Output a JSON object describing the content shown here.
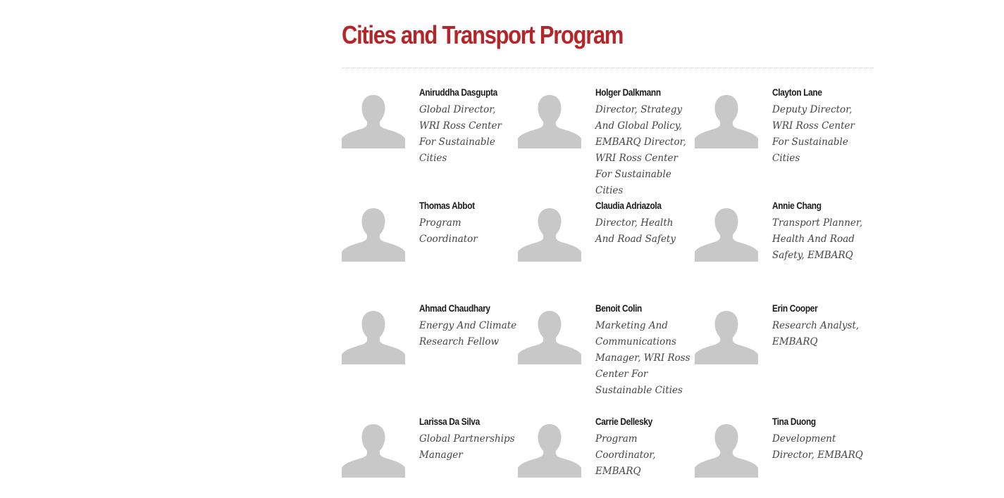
{
  "section": {
    "title": "Cities and Transport Program"
  },
  "avatar_icon": "person-silhouette-placeholder",
  "colors": {
    "title": "#b5262a",
    "avatar": "#c8c8c8",
    "name": "#1a1a1a",
    "role": "#444444"
  },
  "people": [
    {
      "name": "Aniruddha Dasgupta",
      "role": "Global Director, WRI Ross Center For Sustainable Cities"
    },
    {
      "name": "Holger Dalkmann",
      "role": "Director, Strategy And Global Policy, EMBARQ Director, WRI Ross Center For Sustainable Cities"
    },
    {
      "name": "Clayton Lane",
      "role": "Deputy Director, WRI Ross Center For Sustainable Cities"
    },
    {
      "name": "Thomas Abbot",
      "role": "Program Coordinator"
    },
    {
      "name": "Claudia Adriazola",
      "role": "Director, Health And Road Safety"
    },
    {
      "name": "Annie Chang",
      "role": "Transport Planner, Health And Road Safety, EMBARQ"
    },
    {
      "name": "Ahmad Chaudhary",
      "role": "Energy And Climate Research Fellow"
    },
    {
      "name": "Benoit Colin",
      "role": "Marketing And Communications Manager, WRI Ross Center For Sustainable Cities"
    },
    {
      "name": "Erin Cooper",
      "role": "Research Analyst, EMBARQ"
    },
    {
      "name": "Larissa Da Silva",
      "role": "Global Partnerships Manager"
    },
    {
      "name": "Carrie Dellesky",
      "role": "Program Coordinator, EMBARQ"
    },
    {
      "name": "Tina Duong",
      "role": "Development Director, EMBARQ"
    }
  ]
}
